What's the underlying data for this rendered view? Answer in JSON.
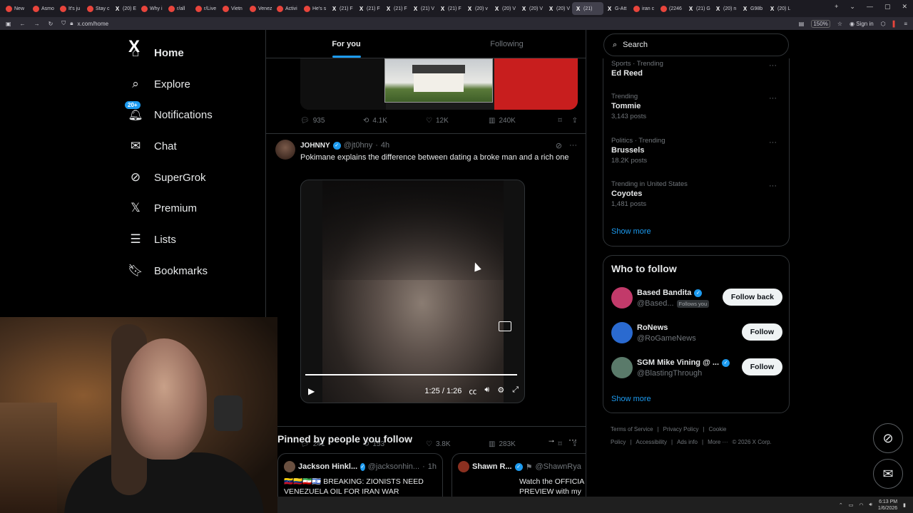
{
  "browser": {
    "tabs": [
      {
        "label": "New",
        "fav": "red"
      },
      {
        "label": "Asmo",
        "fav": "red"
      },
      {
        "label": "It's ju",
        "fav": "red"
      },
      {
        "label": "Stay c",
        "fav": "red"
      },
      {
        "label": "(20) E",
        "fav": "x"
      },
      {
        "label": "Why i",
        "fav": "red"
      },
      {
        "label": "r/all",
        "fav": "red"
      },
      {
        "label": "r/Live",
        "fav": "red"
      },
      {
        "label": "Vietn",
        "fav": "red"
      },
      {
        "label": "Venez",
        "fav": "red"
      },
      {
        "label": "Activi",
        "fav": "red"
      },
      {
        "label": "He's s",
        "fav": "red"
      },
      {
        "label": "(21) F",
        "fav": "x"
      },
      {
        "label": "(21) F",
        "fav": "x"
      },
      {
        "label": "(21) F",
        "fav": "x"
      },
      {
        "label": "(21) V",
        "fav": "x"
      },
      {
        "label": "(21) F",
        "fav": "x"
      },
      {
        "label": "(20) v",
        "fav": "x"
      },
      {
        "label": "(20) V",
        "fav": "x"
      },
      {
        "label": "(20) V",
        "fav": "x"
      },
      {
        "label": "(20) V",
        "fav": "x"
      },
      {
        "label": "(21)",
        "fav": "x",
        "active": true
      },
      {
        "label": "G-Att",
        "fav": "x"
      },
      {
        "label": "iran c",
        "fav": "red"
      },
      {
        "label": "(2246",
        "fav": "red"
      },
      {
        "label": "(21) G",
        "fav": "x"
      },
      {
        "label": "(20) n",
        "fav": "x"
      },
      {
        "label": "G98b",
        "fav": "x"
      },
      {
        "label": "(20) L",
        "fav": "x"
      }
    ],
    "url": "x.com/home",
    "zoom": "150%",
    "signin": "Sign in"
  },
  "nav": {
    "logo": "X",
    "items": [
      {
        "label": "Home",
        "icon": "home-icon",
        "glyph": "⌂",
        "bold": true
      },
      {
        "label": "Explore",
        "icon": "search-icon",
        "glyph": "⌕"
      },
      {
        "label": "Notifications",
        "icon": "bell-icon",
        "glyph": "🔔︎",
        "badge": "20+"
      },
      {
        "label": "Chat",
        "icon": "mail-icon",
        "glyph": "✉"
      },
      {
        "label": "SuperGrok",
        "icon": "grok-icon",
        "glyph": "⊘"
      },
      {
        "label": "Premium",
        "icon": "x-premium-icon",
        "glyph": "𝕏"
      },
      {
        "label": "Lists",
        "icon": "list-icon",
        "glyph": "☰"
      },
      {
        "label": "Bookmarks",
        "icon": "bookmark-icon",
        "glyph": "🔖︎"
      }
    ]
  },
  "feed": {
    "tabs": [
      "For you",
      "Following"
    ],
    "prev_actions": {
      "replies": "935",
      "reposts": "4.1K",
      "likes": "12K",
      "views": "240K"
    },
    "tweet": {
      "name": "JOHNNY",
      "handle": "@jt0hny",
      "time": "4h",
      "text": "Pokimane explains the difference between dating a broke man and a rich one",
      "video_time": "1:25 / 1:26",
      "video_progress": 0.99,
      "actions": {
        "replies": "241",
        "reposts": "153",
        "likes": "3.8K",
        "views": "283K"
      }
    },
    "pinned": {
      "title": "Pinned by people you follow",
      "cards": [
        {
          "name": "Jackson Hinkl...",
          "handle": "@jacksonhin...",
          "time": "1h",
          "text": "🇻🇪🇨🇴🇮🇷🇮🇱 BREAKING: ZIONISTS NEED VENEZUELA OIL FOR IRAN WAR"
        },
        {
          "name": "Shawn R...",
          "handle": "@ShawnRya",
          "time": "",
          "text": "Watch the OFFICIA PREVIEW with my"
        }
      ]
    }
  },
  "search": {
    "placeholder": "Search"
  },
  "trends": [
    {
      "category": "Sports · Trending",
      "title": "Ed Reed",
      "count": ""
    },
    {
      "category": "Trending",
      "title": "Tommie",
      "count": "3,143 posts"
    },
    {
      "category": "Politics · Trending",
      "title": "Brussels",
      "count": "18.2K posts"
    },
    {
      "category": "Trending in United States",
      "title": "Coyotes",
      "count": "1,481 posts"
    }
  ],
  "trends_show_more": "Show more",
  "who_to_follow": {
    "title": "Who to follow",
    "users": [
      {
        "name": "Based Bandita",
        "handle": "@Based...",
        "follows_you": "Follows you",
        "button": "Follow back",
        "verified": true,
        "color": "#c23a6a"
      },
      {
        "name": "RoNews",
        "handle": "@RoGameNews",
        "follows_you": "",
        "button": "Follow",
        "verified": false,
        "color": "#2a6ad0"
      },
      {
        "name": "SGM Mike Vining @ ...",
        "handle": "@BlastingThrough",
        "follows_you": "",
        "button": "Follow",
        "verified": true,
        "color": "#5a7a6a"
      }
    ],
    "show_more": "Show more"
  },
  "footer": {
    "links": [
      "Terms of Service",
      "|",
      "Privacy Policy",
      "|",
      "Cookie Policy",
      "|",
      "Accessibility",
      "|",
      "Ads info",
      "|",
      "More ···",
      "© 2026 X Corp."
    ]
  },
  "taskbar": {
    "time": "6:13 PM",
    "date": "1/6/2026"
  }
}
